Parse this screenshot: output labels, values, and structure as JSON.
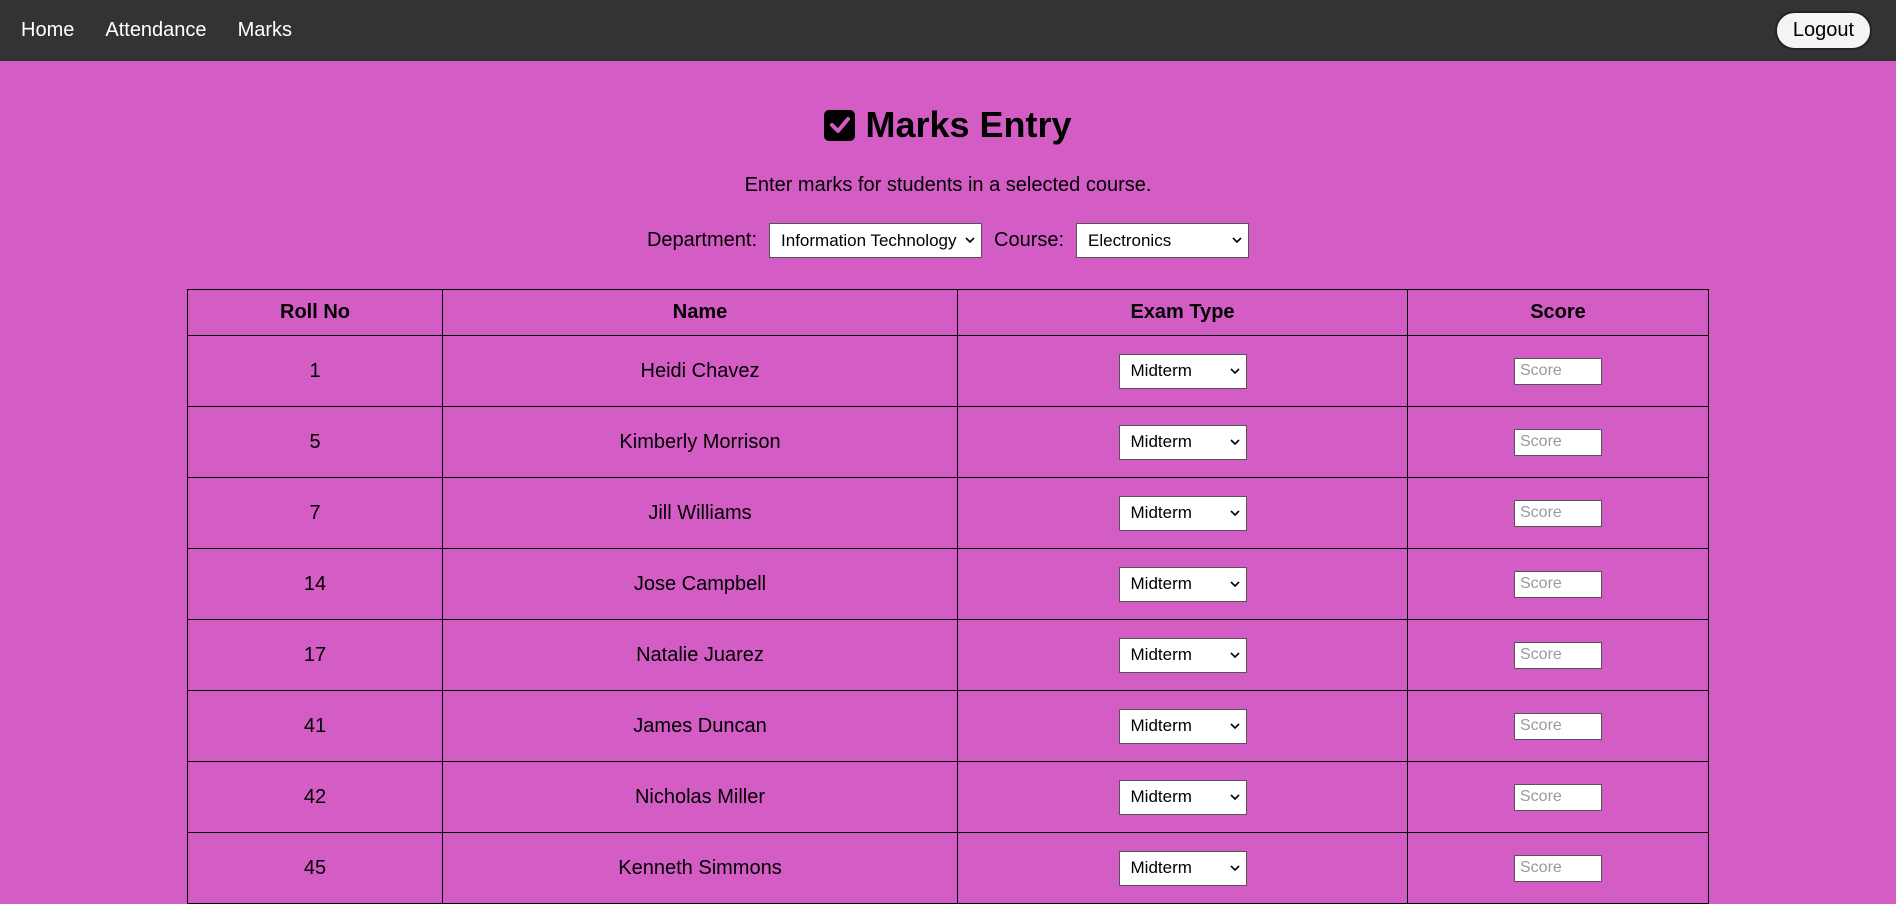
{
  "nav": {
    "links": [
      "Home",
      "Attendance",
      "Marks"
    ],
    "logout_label": "Logout"
  },
  "page": {
    "title": "Marks Entry",
    "subtitle": "Enter marks for students in a selected course."
  },
  "filters": {
    "department_label": "Department:",
    "department_value": "Information Technology",
    "course_label": "Course:",
    "course_value": "Electronics"
  },
  "table": {
    "headers": [
      "Roll No",
      "Name",
      "Exam Type",
      "Score"
    ],
    "score_placeholder": "Score",
    "rows": [
      {
        "roll": "1",
        "name": "Heidi Chavez",
        "exam_type": "Midterm"
      },
      {
        "roll": "5",
        "name": "Kimberly Morrison",
        "exam_type": "Midterm"
      },
      {
        "roll": "7",
        "name": "Jill Williams",
        "exam_type": "Midterm"
      },
      {
        "roll": "14",
        "name": "Jose Campbell",
        "exam_type": "Midterm"
      },
      {
        "roll": "17",
        "name": "Natalie Juarez",
        "exam_type": "Midterm"
      },
      {
        "roll": "41",
        "name": "James Duncan",
        "exam_type": "Midterm"
      },
      {
        "roll": "42",
        "name": "Nicholas Miller",
        "exam_type": "Midterm"
      },
      {
        "roll": "45",
        "name": "Kenneth Simmons",
        "exam_type": "Midterm"
      }
    ]
  },
  "colors": {
    "page_background": "#d35cc5",
    "navbar_background": "#333333"
  },
  "icons": {
    "title_icon": "checkbox-check-icon",
    "select_chevron": "chevron-down-icon"
  }
}
